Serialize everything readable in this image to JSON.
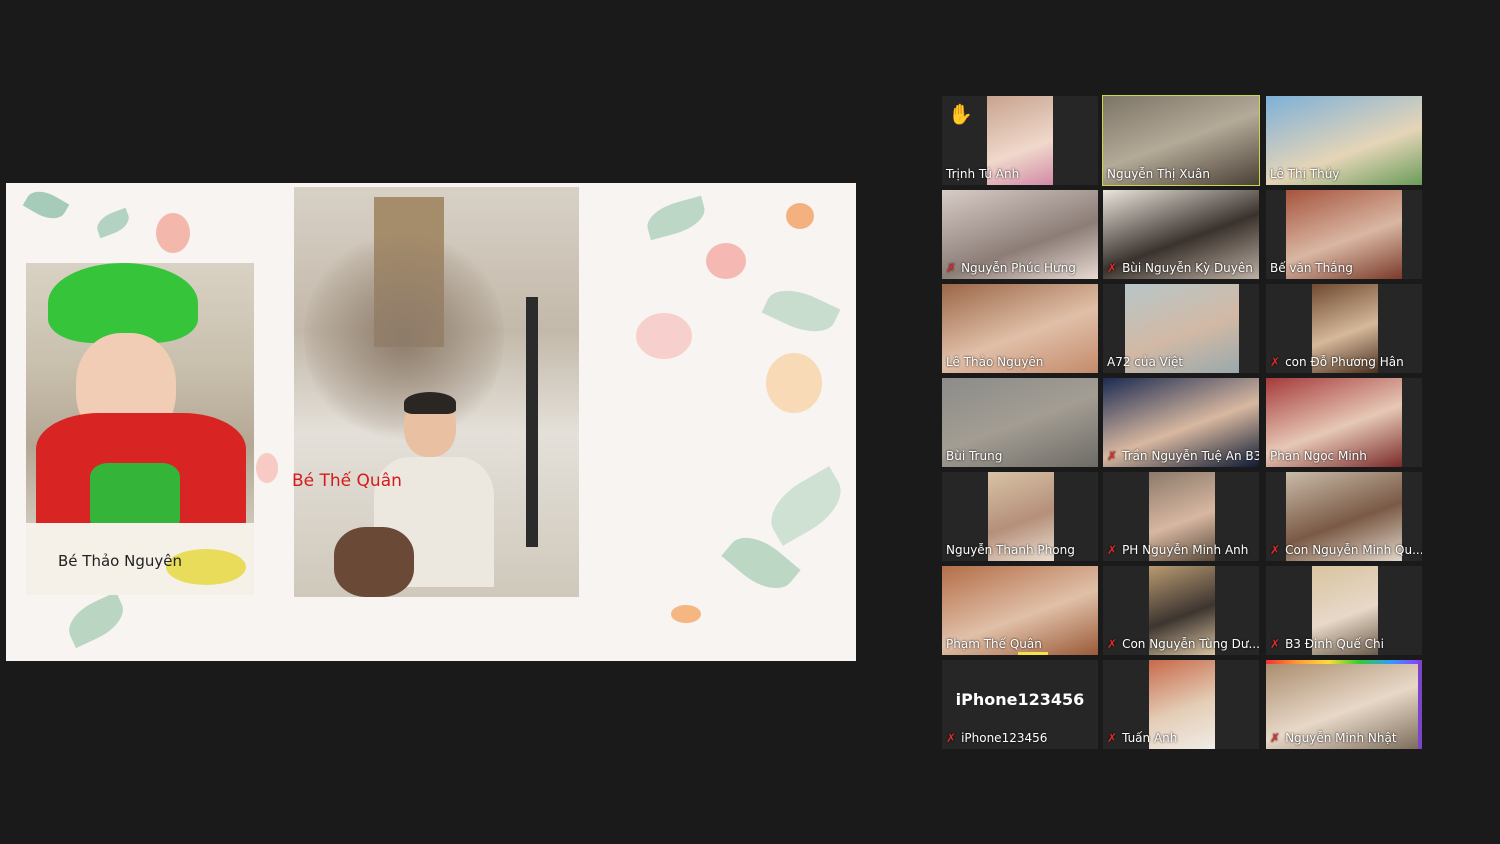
{
  "shared_screen": {
    "caption_left": "Bé Thảo Nguyên",
    "caption_right": "Bé Thế Quân"
  },
  "participants": [
    {
      "name": "Trịnh Tú Anh",
      "muted": false,
      "raised_hand": true
    },
    {
      "name": "Nguyễn Thị Xuân",
      "muted": false,
      "active_speaker": true
    },
    {
      "name": "Lê Thị Thủy",
      "muted": false
    },
    {
      "name": "Nguyễn Phúc Hưng",
      "muted": true
    },
    {
      "name": "Bùi Nguyễn Kỳ Duyên",
      "muted": true
    },
    {
      "name": "Bế văn Thắng",
      "muted": false
    },
    {
      "name": "Lê Thảo Nguyên",
      "muted": false
    },
    {
      "name": "A72 của Việt",
      "muted": false
    },
    {
      "name": "con Đỗ Phương Hân",
      "muted": true
    },
    {
      "name": "Bùi Trung",
      "muted": false
    },
    {
      "name": "Trần Nguyễn Tuệ An B3",
      "muted": true
    },
    {
      "name": "Phan Ngọc Minh",
      "muted": false
    },
    {
      "name": "Nguyễn Thanh Phong",
      "muted": false
    },
    {
      "name": "PH Nguyễn Minh Anh",
      "muted": true
    },
    {
      "name": "Con Nguyễn Minh Qu...",
      "muted": true
    },
    {
      "name": "Phạm Thế Quân",
      "muted": false
    },
    {
      "name": "Con Nguyễn Tùng Dư...",
      "muted": true
    },
    {
      "name": "B3 Đinh Quế Chi",
      "muted": true
    },
    {
      "name": "iPhone123456",
      "muted": true,
      "no_video_title": "iPhone123456"
    },
    {
      "name": "Tuấn Anh",
      "muted": true
    },
    {
      "name": "Nguyễn Minh Nhật",
      "muted": true
    }
  ],
  "icons": {
    "muted_mic": "muted-mic-icon",
    "raised_hand": "raised-hand-icon"
  },
  "colors": {
    "active_speaker_border": "#cdd64a",
    "muted_mic": "#e02a2a",
    "caption_red": "#d41a1a"
  }
}
